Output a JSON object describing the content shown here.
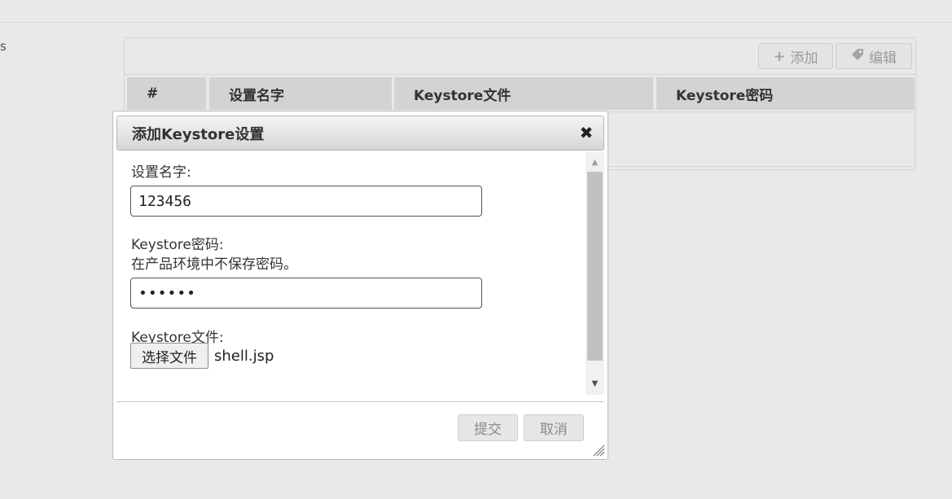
{
  "background": {
    "left_glyph": "s"
  },
  "toolbar": {
    "add_icon": "plus-icon",
    "add_label": "添加",
    "edit_icon": "tag-icon",
    "edit_label": "编辑"
  },
  "table": {
    "columns": [
      "#",
      "设置名字",
      "Keystore文件",
      "Keystore密码"
    ]
  },
  "dialog": {
    "title": "添加Keystore设置",
    "close_icon": "close-icon",
    "fields": {
      "name_label": "设置名字:",
      "name_value": "123456",
      "password_label": "Keystore密码:",
      "password_note": "在产品环境中不保存密码。",
      "password_value": "123456",
      "file_label": "Keystore文件:",
      "file_button": "选择文件",
      "file_name": "shell.jsp"
    },
    "buttons": {
      "submit": "提交",
      "cancel": "取消"
    }
  },
  "colors": {
    "page_bg": "#e9e9e9",
    "header_bg": "#d3d3d3",
    "dialog_bg": "#ffffff"
  }
}
